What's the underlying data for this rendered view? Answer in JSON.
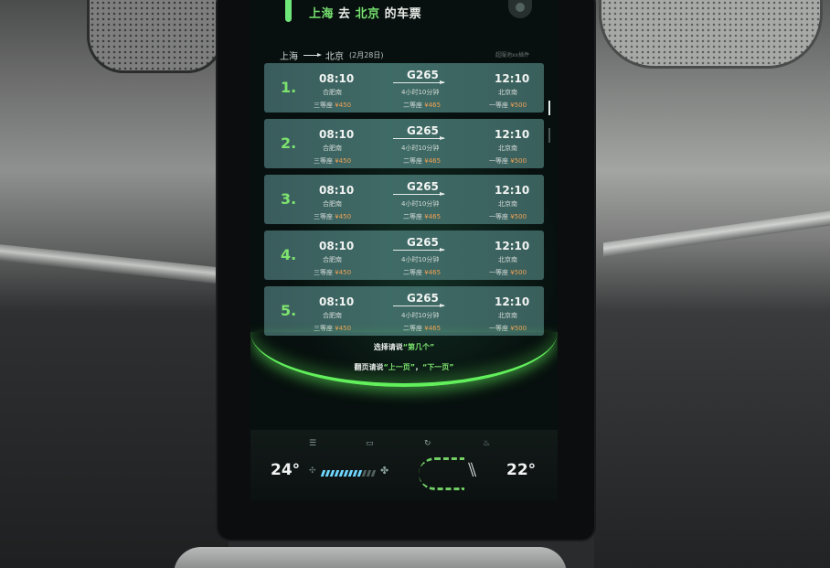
{
  "header": {
    "from_city": "上海",
    "connector": "去",
    "to_city": "北京",
    "suffix": "的车票"
  },
  "route": {
    "from": "上海",
    "to": "北京",
    "date": "(2月28日)",
    "hint": "超服池xx插件"
  },
  "tickets": [
    {
      "index": "1.",
      "dep_time": "08:10",
      "dep_station": "合肥南",
      "train": "G265",
      "duration": "4小时10分钟",
      "arr_time": "12:10",
      "arr_station": "北京南",
      "seat1_label": "三等座",
      "seat1_price": "¥450",
      "seat2_label": "二等座",
      "seat2_price": "¥465",
      "seat3_label": "一等座",
      "seat3_price": "¥500"
    },
    {
      "index": "2.",
      "dep_time": "08:10",
      "dep_station": "合肥南",
      "train": "G265",
      "duration": "4小时10分钟",
      "arr_time": "12:10",
      "arr_station": "北京南",
      "seat1_label": "三等座",
      "seat1_price": "¥450",
      "seat2_label": "二等座",
      "seat2_price": "¥465",
      "seat3_label": "一等座",
      "seat3_price": "¥500"
    },
    {
      "index": "3.",
      "dep_time": "08:10",
      "dep_station": "合肥南",
      "train": "G265",
      "duration": "4小时10分钟",
      "arr_time": "12:10",
      "arr_station": "北京南",
      "seat1_label": "三等座",
      "seat1_price": "¥450",
      "seat2_label": "二等座",
      "seat2_price": "¥465",
      "seat3_label": "一等座",
      "seat3_price": "¥500"
    },
    {
      "index": "4.",
      "dep_time": "08:10",
      "dep_station": "合肥南",
      "train": "G265",
      "duration": "4小时10分钟",
      "arr_time": "12:10",
      "arr_station": "北京南",
      "seat1_label": "三等座",
      "seat1_price": "¥450",
      "seat2_label": "二等座",
      "seat2_price": "¥465",
      "seat3_label": "一等座",
      "seat3_price": "¥500"
    },
    {
      "index": "5.",
      "dep_time": "08:10",
      "dep_station": "合肥南",
      "train": "G265",
      "duration": "4小时10分钟",
      "arr_time": "12:10",
      "arr_station": "北京南",
      "seat1_label": "三等座",
      "seat1_price": "¥450",
      "seat2_label": "二等座",
      "seat2_price": "¥465",
      "seat3_label": "一等座",
      "seat3_price": "¥500"
    }
  ],
  "prompts": {
    "select_prefix": "选择请说",
    "select_hint": "“第几个”",
    "page_prefix": "翻页请说",
    "page_prev": "“上一页”",
    "page_sep": "，",
    "page_next": "“下一页”"
  },
  "climate": {
    "temp_left": "24°",
    "temp_right": "22°",
    "fan_level": 0.75,
    "icons": [
      "defrost-front-icon",
      "defrost-rear-icon",
      "recirculation-icon",
      "seat-heat-icon"
    ]
  },
  "colors": {
    "accent": "#7de36e",
    "price": "#f2a255",
    "card": "#3f6b66",
    "arc_glow": "#62f05c"
  }
}
